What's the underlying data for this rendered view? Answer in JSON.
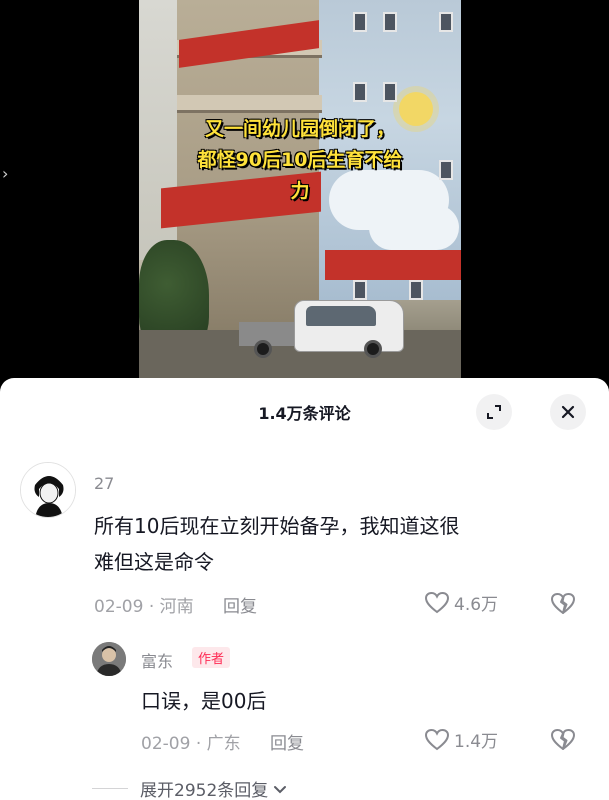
{
  "video": {
    "caption_line1": "又一间幼儿园倒闭了，",
    "caption_line2": "都怪90后10后生育不给",
    "caption_line3": "力",
    "back_icon": "chevron-right-icon"
  },
  "comments_panel": {
    "title": "1.4万条评论",
    "expand_icon": "expand-icon",
    "close_icon": "close-icon"
  },
  "comments": [
    {
      "username": "27",
      "text_line1": "所有10后现在立刻开始备孕，我知道这很",
      "text_line2": "难但这是命令",
      "date": "02-09",
      "separator": "·",
      "location": "河南",
      "reply_label": "回复",
      "likes": "4.6万"
    }
  ],
  "replies": [
    {
      "username": "富东",
      "author_tag": "作者",
      "text": "口误，是00后",
      "date": "02-09",
      "separator": "·",
      "location": "广东",
      "reply_label": "回复",
      "likes": "1.4万"
    }
  ],
  "expand_replies_label": "展开2952条回复",
  "colors": {
    "caption": "#ffe23a",
    "author_tag_bg": "#fde8eb",
    "author_tag_fg": "#fe2c55",
    "text_primary": "#161823",
    "text_secondary": "#8a8b91"
  }
}
